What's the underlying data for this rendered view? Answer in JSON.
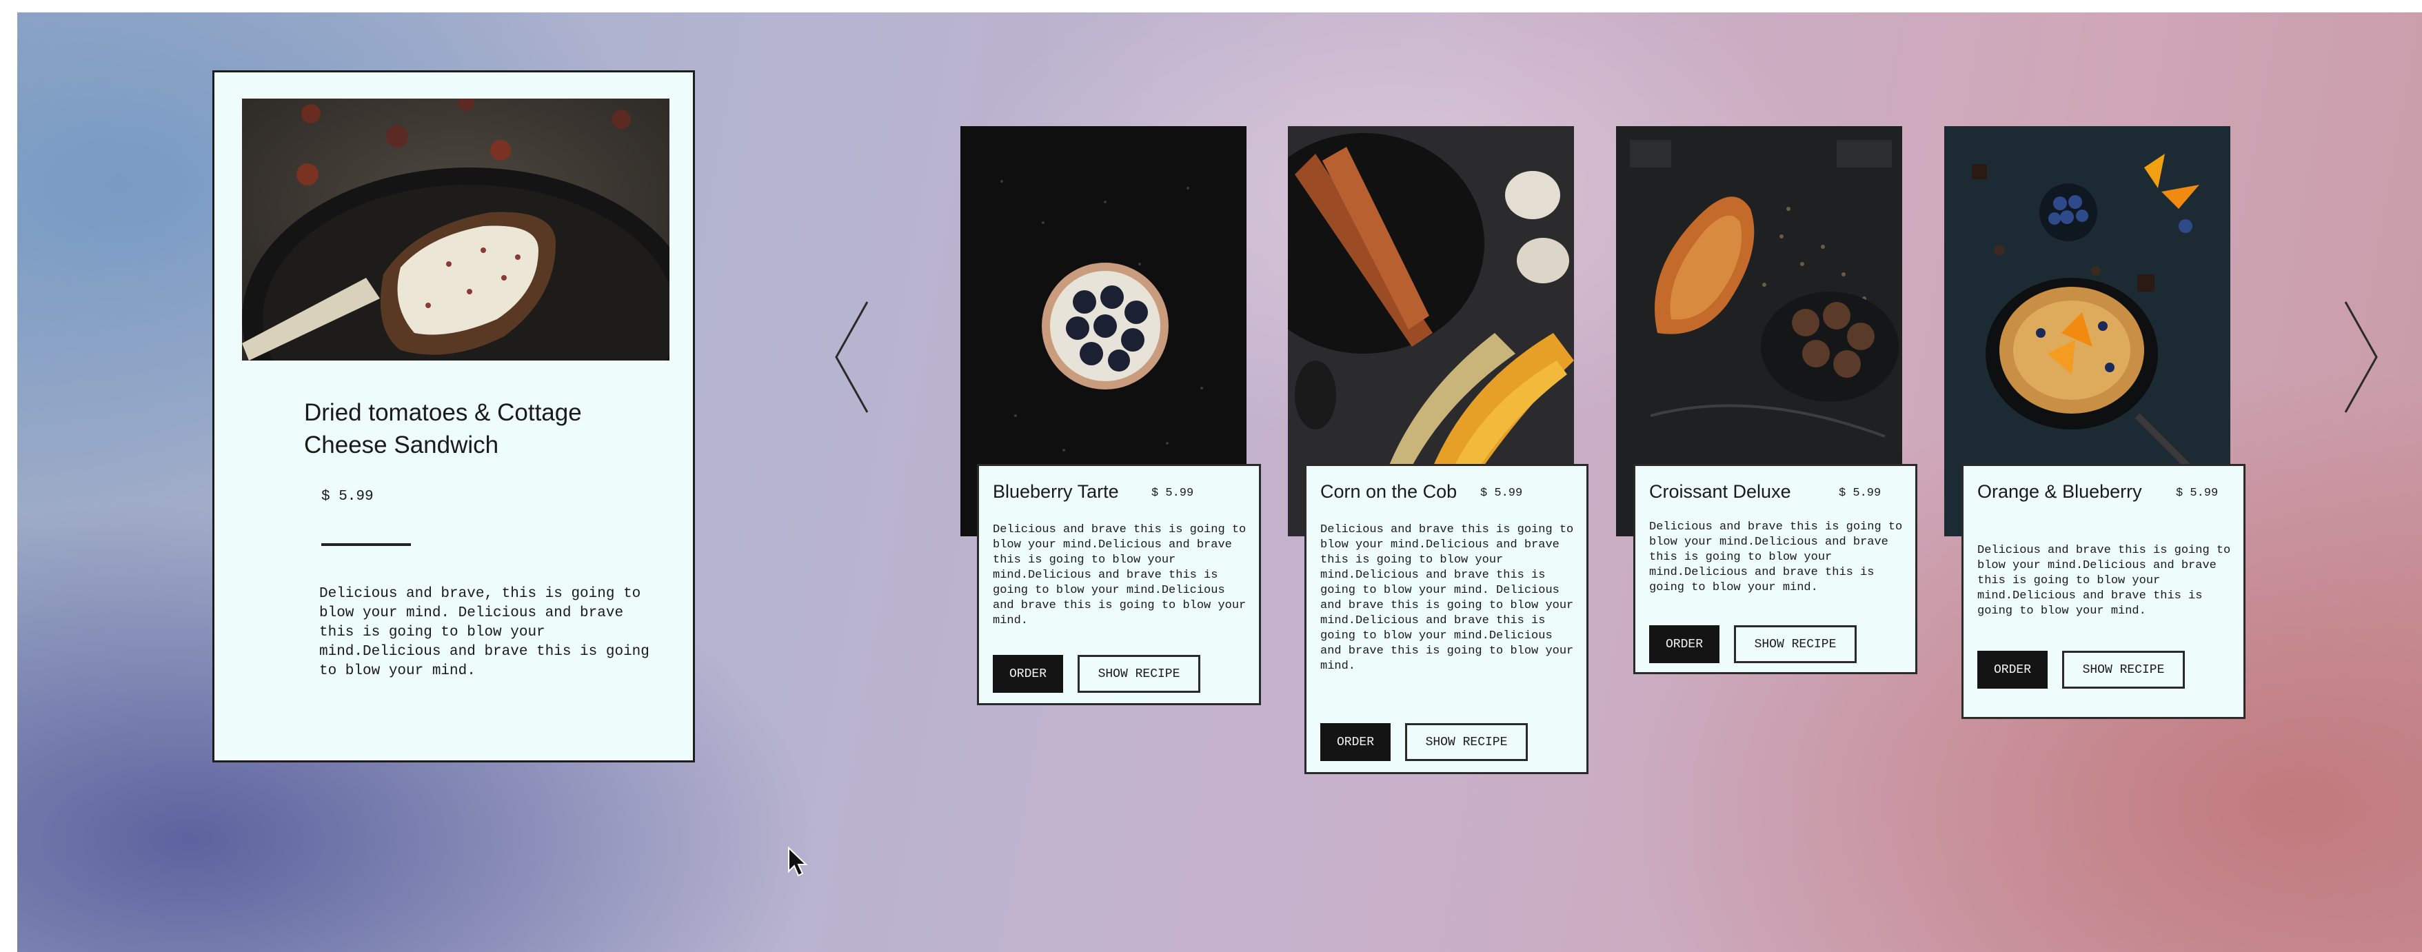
{
  "featured": {
    "title": "Dried tomatoes & Cottage Cheese Sandwich",
    "price": "$ 5.99",
    "description": "Delicious and brave, this is going to blow your mind. Delicious and brave this is going to blow your mind.Delicious and brave this is going to blow your mind."
  },
  "carousel": {
    "prev_icon": "chevron-left-icon",
    "next_icon": "chevron-right-icon",
    "cards": [
      {
        "title": "Blueberry Tarte",
        "price": "$ 5.99",
        "description": "Delicious and brave this is going to blow your mind.Delicious and brave this is going to blow your mind.Delicious and brave this is going to blow your mind.Delicious and brave this is going to blow your mind.",
        "order_label": "ORDER",
        "recipe_label": "SHOW RECIPE"
      },
      {
        "title": "Corn on the Cob",
        "price": "$ 5.99",
        "description": "Delicious and brave this is going to blow your mind.Delicious and brave this is going to blow your mind.Delicious and brave this is going to blow your mind. Delicious and brave this is going to blow your mind.Delicious and brave this is going to blow your mind.Delicious and brave this is going to blow your mind.",
        "order_label": "ORDER",
        "recipe_label": "SHOW RECIPE"
      },
      {
        "title": "Croissant Deluxe",
        "price": "$ 5.99",
        "description": "Delicious and brave this is going to blow your mind.Delicious and brave this is going to blow your mind.Delicious and brave this is going to blow your mind.",
        "order_label": "ORDER",
        "recipe_label": "SHOW RECIPE"
      },
      {
        "title": "Orange & Blueberry",
        "price": "$ 5.99",
        "description": "Delicious and brave this is going to blow your mind.Delicious and brave this is going to blow your mind.Delicious and brave this is going to blow your mind.",
        "order_label": "ORDER",
        "recipe_label": "SHOW RECIPE"
      }
    ]
  },
  "colors": {
    "card_bg": "#eefcfb",
    "button_dark": "#141414",
    "border": "#2a2a2a"
  }
}
